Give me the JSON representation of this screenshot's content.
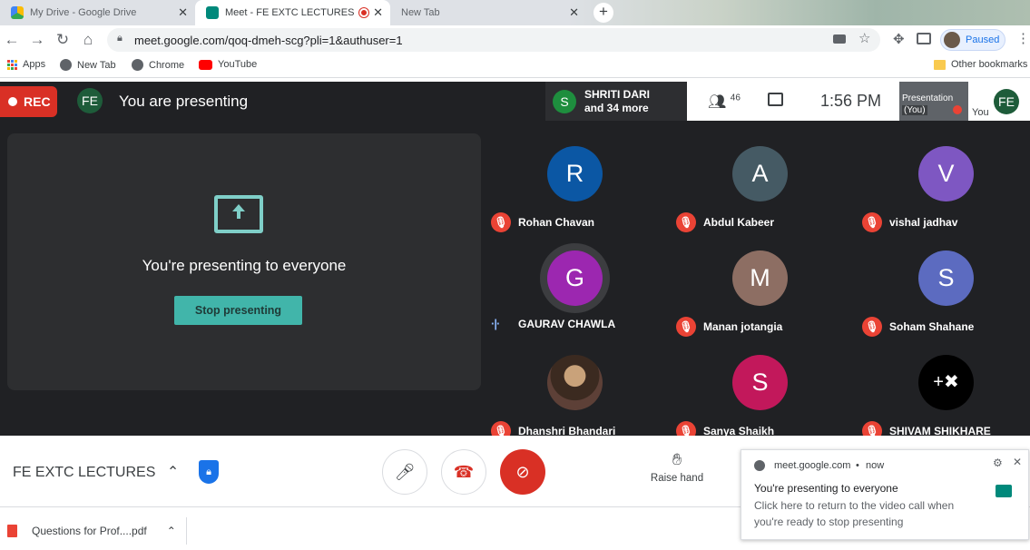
{
  "browser": {
    "tabs": [
      {
        "label": "My Drive - Google Drive",
        "active": false
      },
      {
        "label": "Meet - FE EXTC LECTURES",
        "active": true
      },
      {
        "label": "New Tab",
        "active": false
      }
    ],
    "url": "meet.google.com/qoq-dmeh-scg?pli=1&authuser=1",
    "profile_status": "Paused",
    "bookmarks": [
      "Apps",
      "New Tab",
      "Chrome",
      "YouTube"
    ],
    "other_bookmarks": "Other bookmarks"
  },
  "meet": {
    "rec_label": "REC",
    "user_initials": "FE",
    "presenting_title": "You are presenting",
    "active_speaker": {
      "initial": "S",
      "name": "SHRITI DARI",
      "more": "and 34 more"
    },
    "participant_count": "46",
    "time": "1:56 PM",
    "presentation_thumb": {
      "line1": "Presentation",
      "line2": "(You)"
    },
    "you_label": "You",
    "present_card": {
      "message": "You're presenting to everyone",
      "stop_label": "Stop presenting"
    },
    "participants": [
      {
        "initial": "R",
        "name": "Rohan Chavan",
        "color": "#0b57a4",
        "muted": true
      },
      {
        "initial": "A",
        "name": "Abdul Kabeer",
        "color": "#455a64",
        "muted": true
      },
      {
        "initial": "V",
        "name": "vishal jadhav",
        "color": "#7e57c2",
        "muted": true
      },
      {
        "initial": "G",
        "name": "GAURAV CHAWLA",
        "color": "#9c27b0",
        "muted": false
      },
      {
        "initial": "M",
        "name": "Manan jotangia",
        "color": "#8d6e63",
        "muted": true
      },
      {
        "initial": "S",
        "name": "Soham Shahane",
        "color": "#5c6bc0",
        "muted": true
      },
      {
        "initial": "",
        "name": "Dhanshri Bhandari",
        "color": "#5d4037",
        "muted": true
      },
      {
        "initial": "S",
        "name": "Sanya Shaikh",
        "color": "#c2185b",
        "muted": true
      },
      {
        "initial": "+✖",
        "name": "SHIVAM SHIKHARE",
        "color": "#000000",
        "muted": true
      }
    ],
    "meeting_name": "FE EXTC LECTURES",
    "raise_hand_label": "Raise hand"
  },
  "downloads": {
    "file": "Questions for Prof....pdf"
  },
  "notification": {
    "source": "meet.google.com",
    "when": "now",
    "title": "You're presenting to everyone",
    "body": "Click here to return to the video call when you're ready to stop presenting"
  }
}
